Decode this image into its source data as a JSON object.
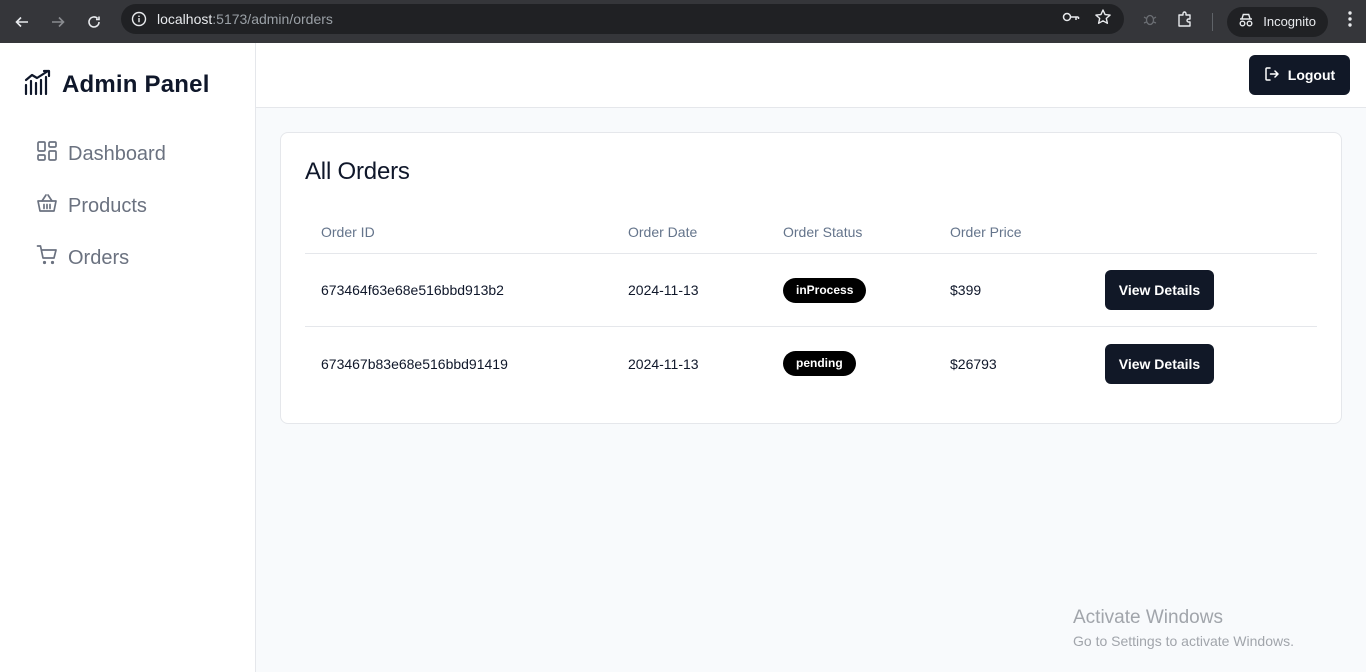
{
  "browser": {
    "url_host": "localhost",
    "url_rest": ":5173/admin/orders",
    "incognito_label": "Incognito"
  },
  "sidebar": {
    "brand": "Admin Panel",
    "items": [
      {
        "label": "Dashboard",
        "icon": "layout-grid-icon"
      },
      {
        "label": "Products",
        "icon": "basket-icon"
      },
      {
        "label": "Orders",
        "icon": "shopping-cart-icon"
      }
    ]
  },
  "header": {
    "logout_label": "Logout"
  },
  "orders": {
    "title": "All Orders",
    "columns": [
      "Order ID",
      "Order Date",
      "Order Status",
      "Order Price",
      ""
    ],
    "rows": [
      {
        "id": "673464f63e68e516bbd913b2",
        "date": "2024-11-13",
        "status": "inProcess",
        "price": "$399",
        "action": "View Details"
      },
      {
        "id": "673467b83e68e516bbd91419",
        "date": "2024-11-13",
        "status": "pending",
        "price": "$26793",
        "action": "View Details"
      }
    ]
  },
  "watermark": {
    "line1": "Activate Windows",
    "line2": "Go to Settings to activate Windows."
  },
  "colors": {
    "primary_dark": "#111827",
    "badge": "#000000",
    "sidebar_text": "#6b7280",
    "browser_chrome": "#35363a"
  }
}
